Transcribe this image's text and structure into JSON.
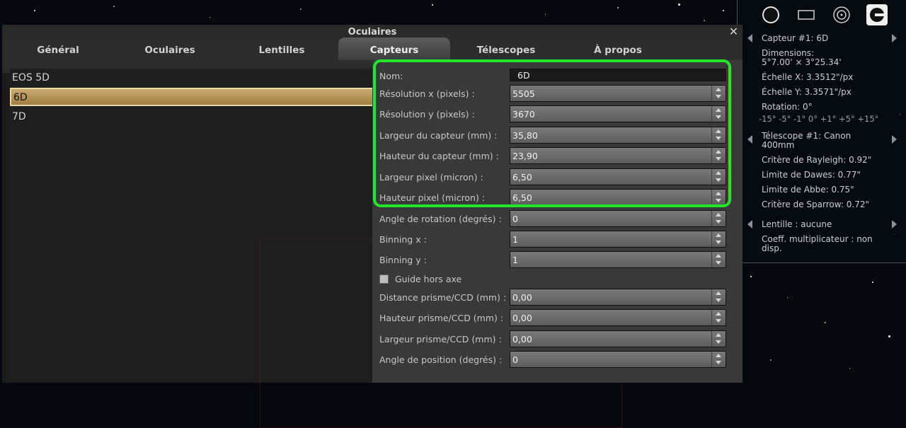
{
  "dialog": {
    "title": "Oculaires",
    "tabs": [
      {
        "label": "Général"
      },
      {
        "label": "Oculaires"
      },
      {
        "label": "Lentilles"
      },
      {
        "label": "Capteurs"
      },
      {
        "label": "Télescopes"
      },
      {
        "label": "À propos"
      }
    ],
    "active_tab": "Capteurs"
  },
  "sensor_list": {
    "items": [
      "EOS 5D",
      "6D",
      "7D"
    ],
    "selected": "6D"
  },
  "sensor_form": {
    "name": {
      "label": "Nom:",
      "value": "6D"
    },
    "res_x": {
      "label": "Résolution x (pixels) :",
      "value": "5505"
    },
    "res_y": {
      "label": "Résolution y (pixels) :",
      "value": "3670"
    },
    "chip_width": {
      "label": "Largeur du capteur (mm) :",
      "value": "35,80"
    },
    "chip_height": {
      "label": "Hauteur du capteur (mm) :",
      "value": "23,90"
    },
    "pixel_width": {
      "label": "Largeur pixel (micron) :",
      "value": "6,50"
    },
    "pixel_height": {
      "label": "Hauteur pixel (micron) :",
      "value": "6,50"
    },
    "rotation": {
      "label": "Angle de rotation (degrés) :",
      "value": "0"
    },
    "binning_x": {
      "label": "Binning x :",
      "value": "1"
    },
    "binning_y": {
      "label": "Binning y :",
      "value": "1"
    },
    "off_axis": {
      "label": "Guide hors axe",
      "checked": false
    },
    "prism_distance": {
      "label": "Distance prisme/CCD (mm) :",
      "value": "0,00"
    },
    "prism_height": {
      "label": "Hauteur prisme/CCD (mm) :",
      "value": "0,00"
    },
    "prism_width": {
      "label": "Largeur prisme/CCD (mm) :",
      "value": "0,00"
    },
    "position_angle": {
      "label": "Angle de position (degrés) :",
      "value": "0"
    }
  },
  "ocular_panel": {
    "top_icons": [
      "circle-fov-icon",
      "rectangle-sensor-icon",
      "telrad-icon",
      "ocular-tool-icon"
    ],
    "sensor_title": "Capteur #1: 6D",
    "dimensions": "Dimensions:\n5°7.00' × 3°25.34'",
    "scale_x": "Échelle X: 3.3512\"/px",
    "scale_y": "Échelle Y: 3.3571\"/px",
    "rotation": "Rotation: 0°",
    "rotation_steps": "-15° -5° -1° 0° +1° +5° +15°",
    "telescope_title": "Télescope #1: Canon\n400mm",
    "rayleigh": "Critère de Rayleigh: 0.92\"",
    "dawes": "Limite de Dawes: 0.77\"",
    "abbe": "Limite de Abbe: 0.75\"",
    "sparrow": "Critère de Sparrow: 0.72\"",
    "lens_title": "Lentille : aucune",
    "multiplier": "Coeff. multiplicateur : non\ndisp."
  },
  "colors": {
    "highlight": "#22e52c",
    "selection": "#b8975a",
    "active_tab": "#4d4d4d"
  }
}
